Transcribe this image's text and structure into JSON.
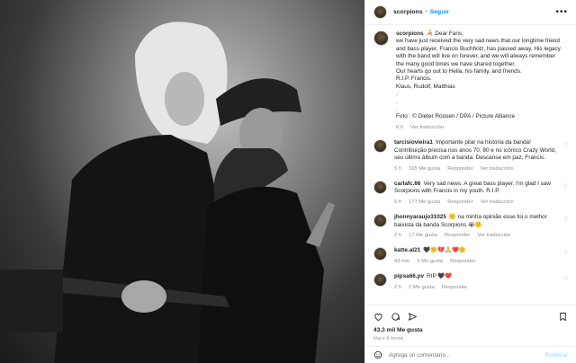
{
  "header": {
    "username": "scorpions",
    "separator": "•",
    "follow_label": "Seguir",
    "more_label": "•••"
  },
  "caption": {
    "username": "scorpions",
    "lines": [
      "🦂 Dear Fans,",
      "we have just received the very sad news that our longtime friend",
      "and bass player, Francis Buchholz, has passed away. His legacy",
      "with the band will live on forever, and we will always remember",
      "the many good times we have shared together.",
      "Our hearts go out to Hella, his family, and friends.",
      "R.I.P. Francis.",
      "Klaus, Rudolf, Matthias",
      ".",
      ".",
      ".",
      "Foto : © Dieter Roosen / DPA / Picture Alliance"
    ],
    "time": "6 h",
    "translate": "Ver traducción"
  },
  "comments": [
    {
      "username": "tarcisiovieira1",
      "lines": [
        "Importante pilar na história da banda!",
        "Contribuição precisa nos anos 70, 80 e no icônico Crazy World,",
        "seu último álbum com a banda. Descanse em paz, Francis."
      ],
      "time": "5 h",
      "likes": "165 Me gusta",
      "reply": "Responder",
      "translate": "Ver traducción"
    },
    {
      "username": "carlafc.66",
      "lines": [
        "Very sad news. A great bass player. I'm glad I saw",
        "Scorpions with Francis in my youth. R.I.P."
      ],
      "time": "5 h",
      "likes": "177 Me gusta",
      "reply": "Responder",
      "translate": "Ver traducción"
    },
    {
      "username": "jhonnyaraujo31025",
      "lines": [
        "🙁 na minha opinião esse foi o melhor",
        "baixista da banda Scorpions 😭🙁"
      ],
      "time": "2 h",
      "likes": "17 Me gusta",
      "reply": "Responder",
      "translate": "Ver traducción"
    },
    {
      "username": "katte.al21",
      "lines": [
        "🖤🙁💔🙏❤️🙁"
      ],
      "time": "43 min",
      "likes": "5 Me gusta",
      "reply": "Responder",
      "translate": ""
    },
    {
      "username": "pipsa66.pv",
      "lines": [
        "RIP 🖤❤️"
      ],
      "time": "2 h",
      "likes": "2 Me gusta",
      "reply": "Responder",
      "translate": ""
    }
  ],
  "stats": {
    "likes": "43,3 mil Me gusta",
    "time": "Hace 6 horas"
  },
  "add_comment": {
    "placeholder": "Agrega un comentario...",
    "publish_label": "Publicar"
  }
}
